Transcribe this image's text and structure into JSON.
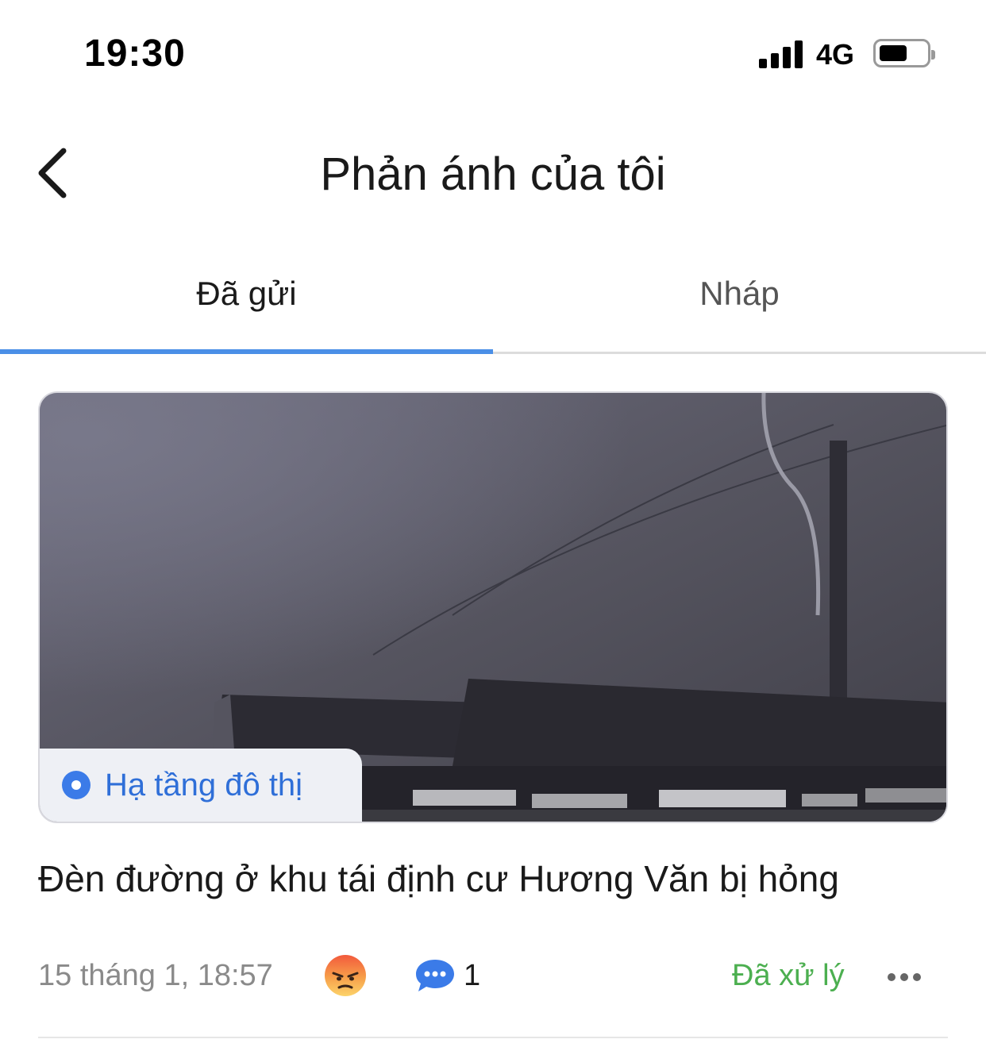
{
  "status_bar": {
    "time": "19:30",
    "network": "4G",
    "battery_level": 0.6
  },
  "header": {
    "title": "Phản ánh của tôi",
    "back_icon": "chevron-left-icon"
  },
  "tabs": [
    {
      "label": "Đã gửi",
      "active": true
    },
    {
      "label": "Nháp",
      "active": false
    }
  ],
  "colors": {
    "accent": "#4a8fe7",
    "category": "#2f6fd8",
    "status_done": "#4caf50"
  },
  "reports": [
    {
      "category": "Hạ tầng đô thị",
      "title": "Đèn đường ở khu tái định cư Hương Văn bị hỏng",
      "date": "15 tháng 1, 18:57",
      "reaction_icon": "angry-face-icon",
      "comment_icon": "chat-bubble-icon",
      "comment_count": "1",
      "status": "Đã xử lý",
      "more_icon": "more-horizontal-icon"
    }
  ]
}
